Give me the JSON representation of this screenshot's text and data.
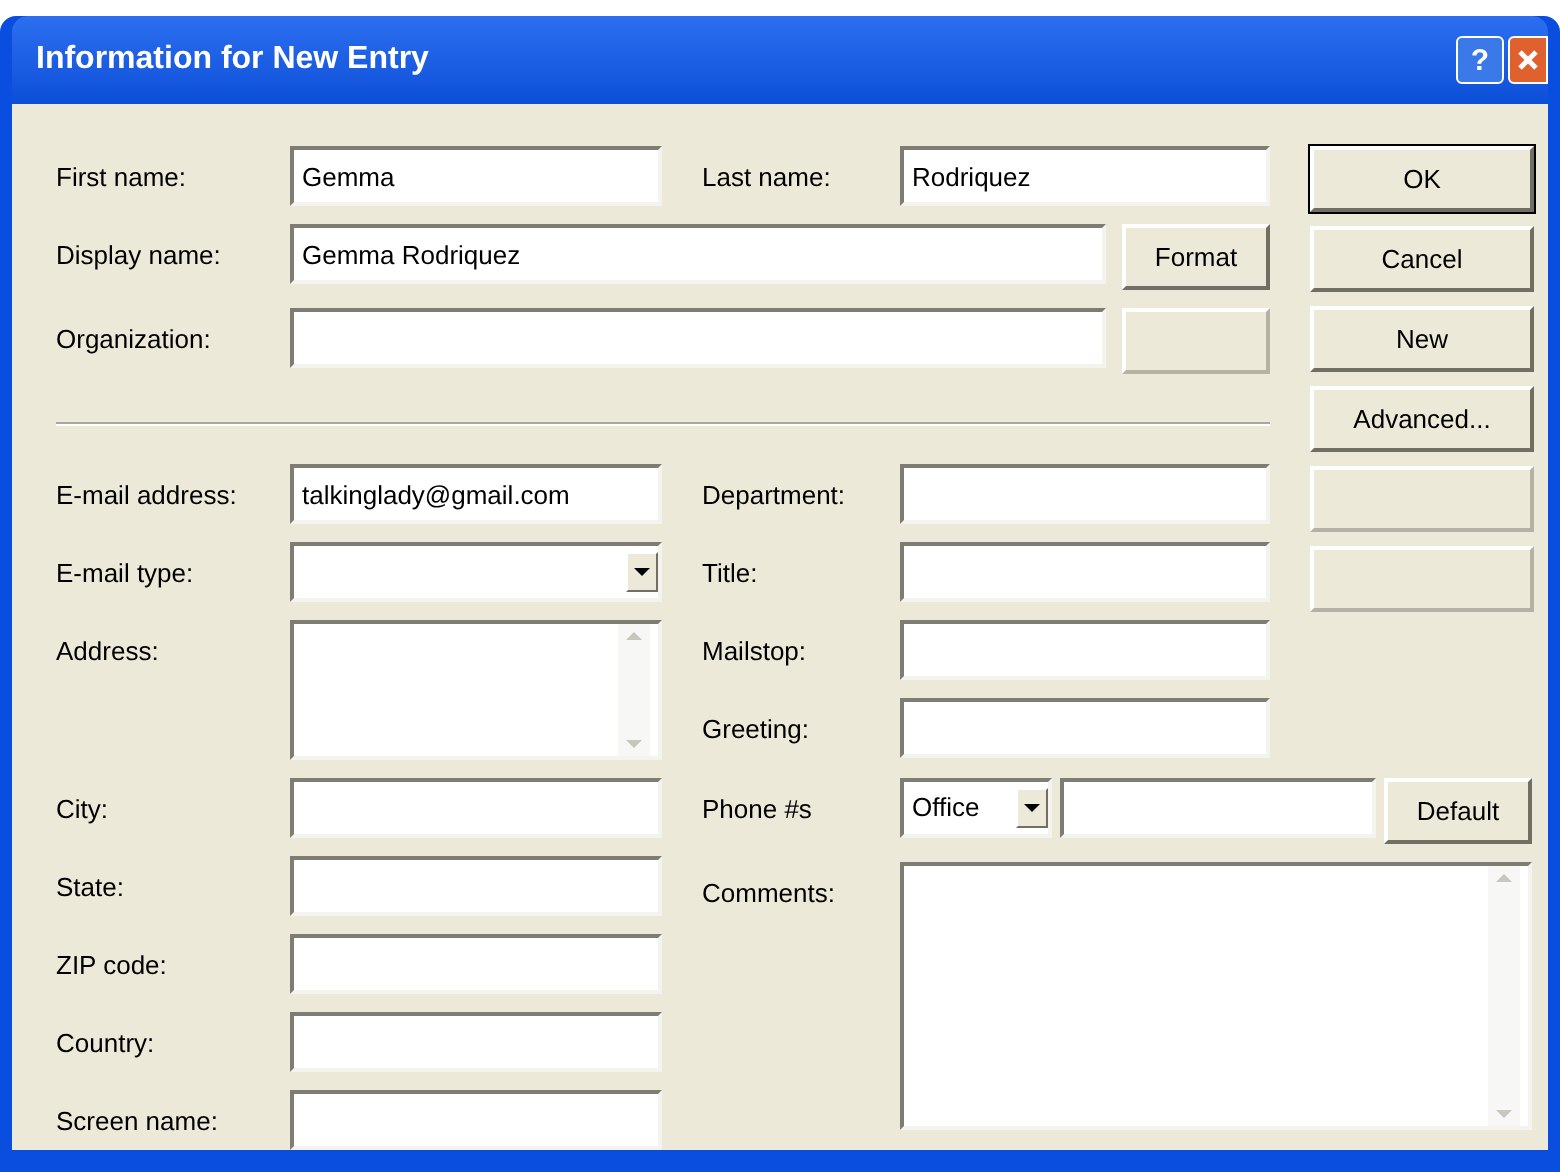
{
  "window": {
    "title": "Information for New Entry",
    "help": "?"
  },
  "first_name": {
    "label": "First name:",
    "value": "Gemma"
  },
  "last_name": {
    "label": "Last name:",
    "value": "Rodriquez"
  },
  "display_name": {
    "label": "Display name:",
    "value": "Gemma Rodriquez",
    "button": {
      "label": "Format",
      "disabled": false
    }
  },
  "organization": {
    "label": "Organization:",
    "button": {
      "disabled": true
    }
  },
  "left_fields": [
    {
      "kind": "text",
      "label": "E-mail address:",
      "value": "talkinglady@gmail.com"
    },
    {
      "kind": "dropdown",
      "label": "E-mail type:"
    },
    {
      "kind": "textarea",
      "label": "Address:"
    },
    {
      "kind": "text",
      "label": "City:"
    },
    {
      "kind": "text",
      "label": "State:"
    },
    {
      "kind": "text",
      "label": "ZIP code:"
    },
    {
      "kind": "text",
      "label": "Country:"
    },
    {
      "kind": "text",
      "label": "Screen name:"
    }
  ],
  "right_fields": [
    {
      "kind": "text",
      "label": "Department:"
    },
    {
      "kind": "text",
      "label": "Title:"
    },
    {
      "kind": "text",
      "label": "Mailstop:"
    },
    {
      "kind": "text",
      "label": "Greeting:"
    },
    {
      "kind": "phone",
      "label": "Phone #s",
      "type": "Office",
      "button": "Default"
    },
    {
      "kind": "textarea",
      "label": "Comments:"
    }
  ],
  "buttons": [
    {
      "label": "OK",
      "default": true,
      "disabled": false
    },
    {
      "label": "Cancel",
      "default": false,
      "disabled": false
    },
    {
      "label": "New",
      "default": false,
      "disabled": false
    },
    {
      "label": "Advanced...",
      "default": false,
      "disabled": false
    },
    {
      "default": false,
      "disabled": true
    },
    {
      "default": false,
      "disabled": true
    }
  ]
}
